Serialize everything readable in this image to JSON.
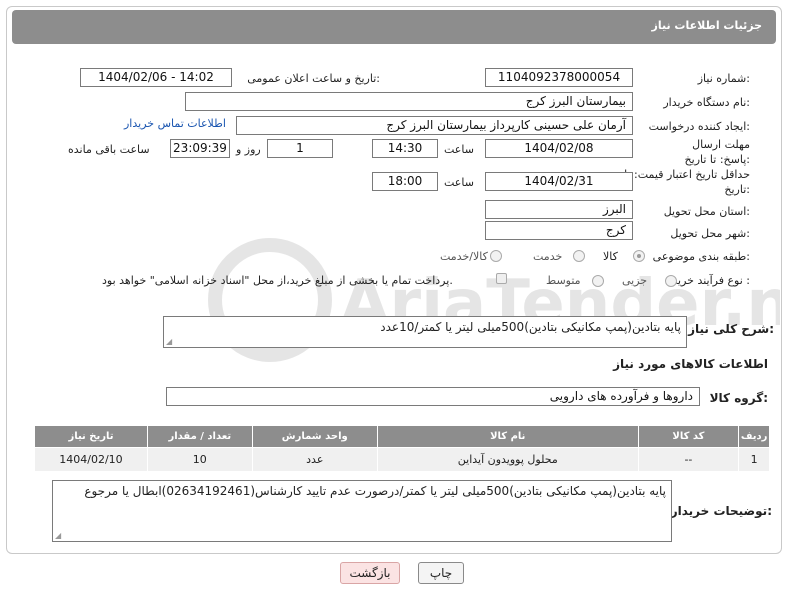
{
  "header": {
    "title": "جزئیات اطلاعات نیاز"
  },
  "fields": {
    "need_number_label": "شماره نیاز:",
    "need_number": "1104092378000054",
    "announce_label": "تاریخ و ساعت اعلان عمومی:",
    "announce_value": "1404/02/06 - 14:02",
    "buyer_org_label": "نام دستگاه خریدار:",
    "buyer_org": "بیمارستان البرز کرج",
    "creator_label": "ایجاد کننده درخواست:",
    "creator": "آرمان علی حسینی کارپرداز بیمارستان البرز کرج",
    "contact_link": "اطلاعات تماس خریدار",
    "deadline_label": "مهلت ارسال پاسخ: تا تاریخ:",
    "deadline_date": "1404/02/08",
    "time_label": "ساعت",
    "deadline_time": "14:30",
    "days_value": "1",
    "days_label": "روز و",
    "remaining_value": "23:09:39",
    "remaining_label": "ساعت باقی مانده",
    "validity_label": "حداقل تاریخ اعتبار قیمت: تا تاریخ:",
    "validity_date": "1404/02/31",
    "validity_time": "18:00",
    "province_label": "استان محل تحویل:",
    "province": "البرز",
    "city_label": "شهر محل تحویل:",
    "city": "کرج",
    "category_label": "طبقه بندی موضوعی:",
    "category_options": [
      "کالا",
      "خدمت",
      "کالا/خدمت"
    ],
    "process_label": "نوع فرآیند خرید :",
    "process_options": [
      "جزیی",
      "متوسط"
    ],
    "payment_note": "پرداخت تمام یا بخشی از مبلغ خرید،از محل \"اسناد خزانه اسلامی\" خواهد بود."
  },
  "summary": {
    "label": "شرح کلی نیاز:",
    "value": "پایه بتادین(پمپ مکانیکی بتادین)500میلی لیتر یا کمتر/10عدد"
  },
  "goods": {
    "section_title": "اطلاعات کالاهای مورد نیاز",
    "group_label": "گروه کالا:",
    "group_value": "داروها و فرآورده های دارویی",
    "columns": [
      "ردیف",
      "کد کالا",
      "نام کالا",
      "واحد شمارش",
      "تعداد / مقدار",
      "تاریخ نیاز"
    ],
    "rows": [
      {
        "row": "1",
        "code": "--",
        "name": "محلول پوویدون آیداین",
        "unit": "عدد",
        "qty": "10",
        "date": "1404/02/10"
      }
    ]
  },
  "buyer_notes": {
    "label": "توضیحات خریدار:",
    "value": "پایه بتادین(پمپ مکانیکی بتادین)500میلی لیتر یا کمتر/درصورت عدم تایید کارشناس(02634192461)ابطال یا مرجوع"
  },
  "buttons": {
    "print": "چاپ",
    "back": "بازگشت"
  },
  "watermark_text": "AriaTender.neT"
}
